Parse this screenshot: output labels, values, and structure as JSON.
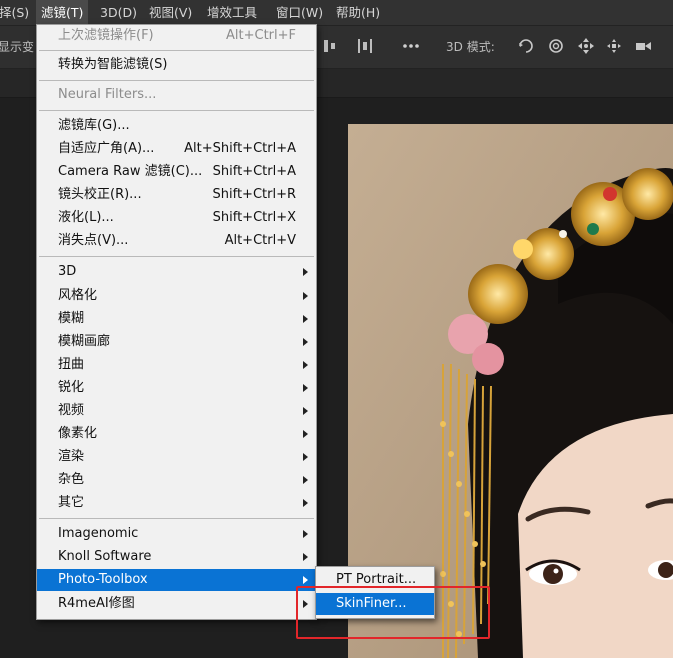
{
  "menubar": {
    "items": [
      "择(S)",
      "滤镜(T)",
      "3D(D)",
      "视图(V)",
      "增效工具",
      "窗口(W)",
      "帮助(H)"
    ]
  },
  "options": {
    "left_text": "显示变",
    "mode_label": "3D 模式:",
    "more_icon": "more-dots-icon",
    "icons": [
      "align-icon",
      "rotate-3d-icon",
      "roll-3d-icon",
      "pan-3d-icon",
      "slide-3d-icon",
      "scale-3d-icon"
    ]
  },
  "filter_menu": {
    "items": [
      {
        "label": "上次滤镜操作(F)",
        "shortcut": "Alt+Ctrl+F",
        "disabled": true
      },
      {
        "label": "转换为智能滤镜(S)",
        "shortcut": ""
      },
      {
        "label": "Neural Filters...",
        "shortcut": "",
        "disabled": true
      },
      {
        "label": "滤镜库(G)...",
        "shortcut": ""
      },
      {
        "label": "自适应广角(A)...",
        "shortcut": "Alt+Shift+Ctrl+A"
      },
      {
        "label": "Camera Raw 滤镜(C)...",
        "shortcut": "Shift+Ctrl+A"
      },
      {
        "label": "镜头校正(R)...",
        "shortcut": "Shift+Ctrl+R"
      },
      {
        "label": "液化(L)...",
        "shortcut": "Shift+Ctrl+X"
      },
      {
        "label": "消失点(V)...",
        "shortcut": "Alt+Ctrl+V"
      },
      {
        "label": "3D",
        "submenu": true
      },
      {
        "label": "风格化",
        "submenu": true
      },
      {
        "label": "模糊",
        "submenu": true
      },
      {
        "label": "模糊画廊",
        "submenu": true
      },
      {
        "label": "扭曲",
        "submenu": true
      },
      {
        "label": "锐化",
        "submenu": true
      },
      {
        "label": "视频",
        "submenu": true
      },
      {
        "label": "像素化",
        "submenu": true
      },
      {
        "label": "渲染",
        "submenu": true
      },
      {
        "label": "杂色",
        "submenu": true
      },
      {
        "label": "其它",
        "submenu": true
      },
      {
        "label": "Imagenomic",
        "submenu": true
      },
      {
        "label": "Knoll Software",
        "submenu": true
      },
      {
        "label": "Photo-Toolbox",
        "submenu": true,
        "highlighted": true
      },
      {
        "label": "R4meAI修图",
        "submenu": true
      }
    ]
  },
  "submenu": {
    "items": [
      {
        "label": "PT Portrait..."
      },
      {
        "label": "SkinFiner...",
        "highlighted": true
      }
    ]
  },
  "colors": {
    "highlight": "#0a73d4",
    "annotation_box": "#e2262a"
  }
}
